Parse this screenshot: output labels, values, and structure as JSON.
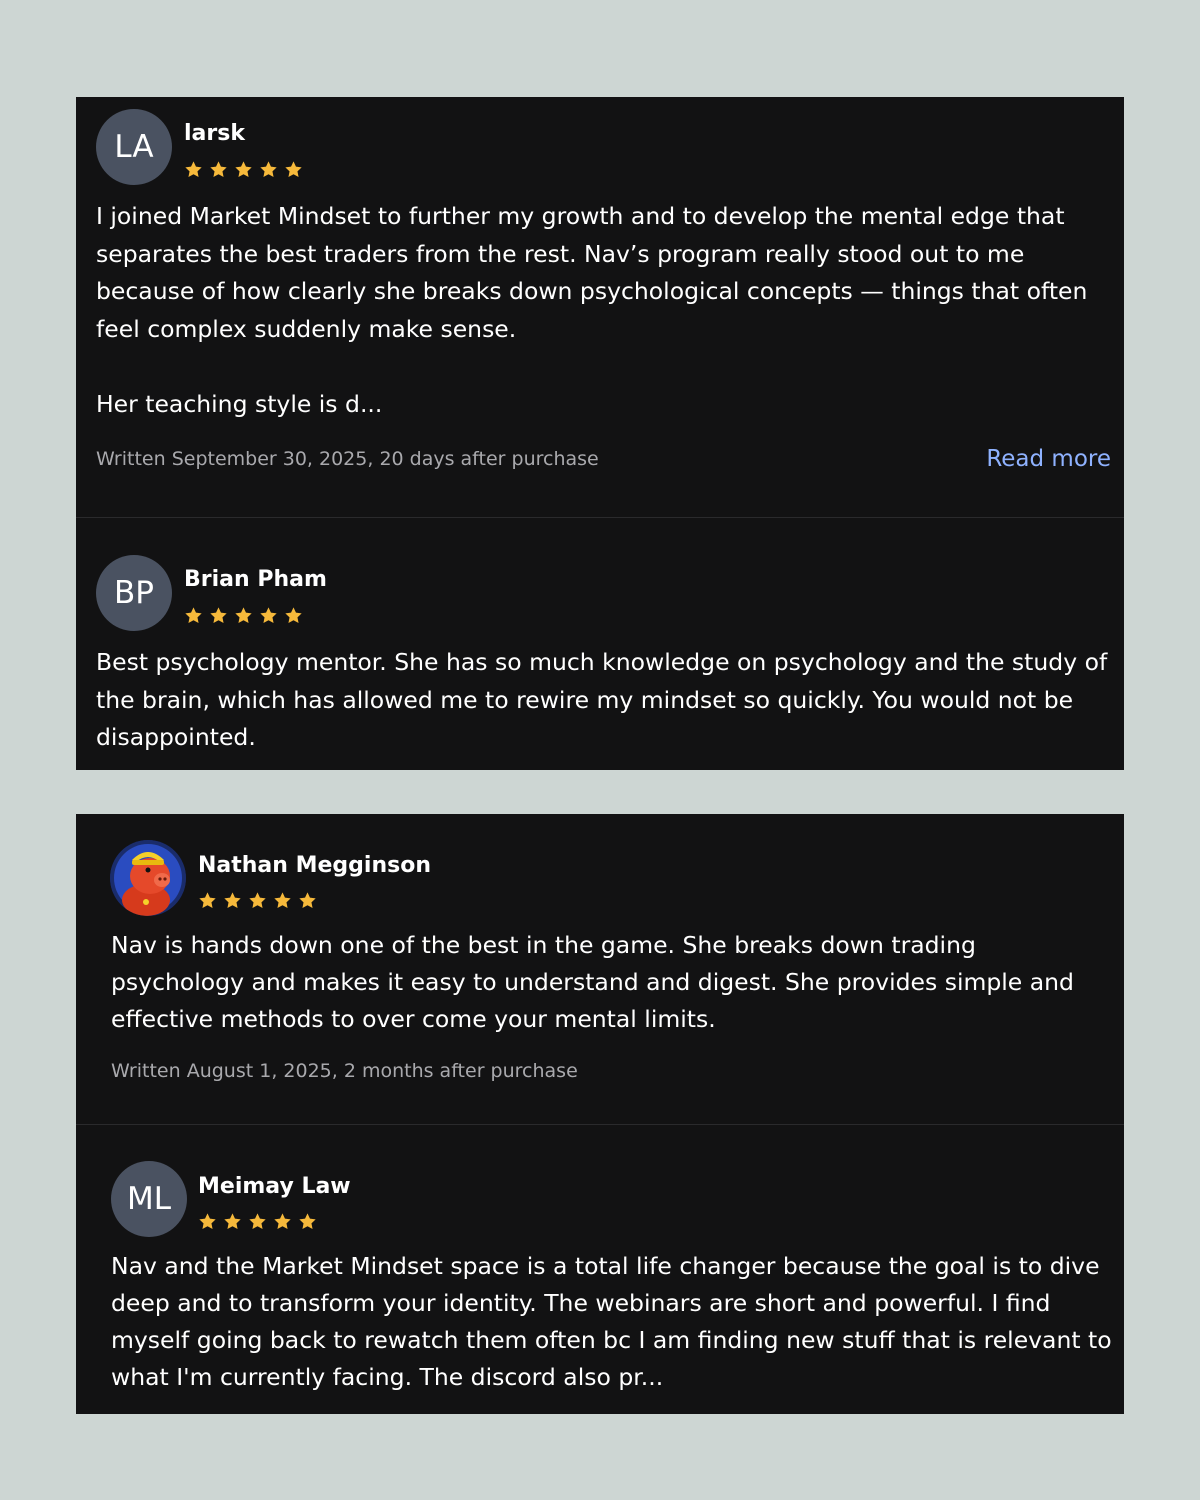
{
  "colors": {
    "page_background": "#cdd6d3",
    "panel_background": "#121213",
    "star": "#f6b93b",
    "avatar_background": "#4a5261",
    "link": "#8fb2ff",
    "meta_text": "#a9a9ad"
  },
  "panels": [
    {
      "reviews": [
        {
          "avatar_initials": "LA",
          "name": "larsk",
          "rating": 5,
          "text": "I joined Market Mindset to further my growth and to develop the mental edge that separates the best traders from the rest. Nav’s program really stood out to me because of how clearly she breaks down psychological concepts — things that often feel complex suddenly make sense.\n\nHer teaching style is d...",
          "written": "Written September 30, 2025, 20 days after purchase",
          "read_more": "Read more"
        },
        {
          "avatar_initials": "BP",
          "name": "Brian Pham",
          "rating": 5,
          "text": "Best psychology mentor. She has so much knowledge on psychology and the study of the brain, which has allowed me to rewire my mindset so quickly. You would not be disappointed."
        }
      ]
    },
    {
      "reviews": [
        {
          "avatar_icon": "pig-mascot-avatar-icon",
          "name": "Nathan Megginson",
          "rating": 5,
          "text": "Nav is hands down one of the best in the game. She breaks down trading psychology and makes it easy to understand and digest. She provides simple and effective methods to over come your mental limits.",
          "written": "Written August 1, 2025, 2 months after purchase"
        },
        {
          "avatar_initials": "ML",
          "name": "Meimay Law",
          "rating": 5,
          "text": "Nav and the Market Mindset space is a total life changer because the goal is to dive deep and to transform your identity. The webinars are short and powerful. I find myself going back to rewatch them often bc I am finding new stuff that is relevant to what I'm currently facing. The discord also pr..."
        }
      ]
    }
  ]
}
